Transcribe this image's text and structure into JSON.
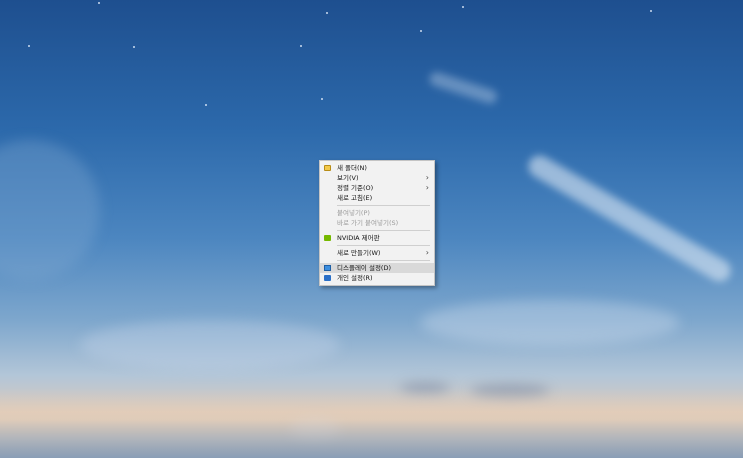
{
  "context_menu": {
    "items": [
      {
        "label": "새 폴더(N)",
        "icon": "new-folder-icon"
      },
      {
        "label": "보기(V)",
        "submenu": true
      },
      {
        "label": "정렬 기준(O)",
        "submenu": true
      },
      {
        "label": "새로 고침(E)"
      },
      {
        "label": "붙여넣기(P)",
        "disabled": true
      },
      {
        "label": "바로 가기 붙여넣기(S)",
        "disabled": true
      },
      {
        "label": "NVIDIA 제어판",
        "icon": "nvidia-icon"
      },
      {
        "label": "새로 만들기(W)",
        "submenu": true
      },
      {
        "label": "디스플레이 설정(D)",
        "icon": "display-icon",
        "highlighted": true
      },
      {
        "label": "개인 설정(R)",
        "icon": "personalize-icon"
      }
    ],
    "submenu_glyph": "›"
  },
  "colors": {
    "menu_background": "#f2f2f2",
    "menu_highlight": "#d9d9d9",
    "disabled_text": "#9a9a9a"
  }
}
